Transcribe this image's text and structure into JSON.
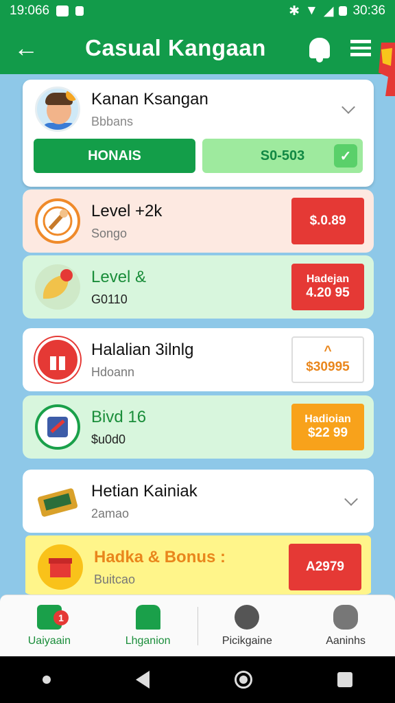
{
  "status_bar": {
    "time_left": "19:066",
    "time_right": "30:36"
  },
  "app_bar": {
    "title": "Casual Kangaan"
  },
  "profile": {
    "name": "Kanan Ksangan",
    "subtitle": "Bbbans",
    "primary_button": "HONAIS",
    "secondary_button": "S0-503"
  },
  "rows": [
    {
      "title": "Level +2k",
      "subtitle": "Songo",
      "pill_line1": "$.0.89",
      "pill_line2": ""
    },
    {
      "title": "Level &",
      "subtitle": "G0110",
      "pill_line1": "Hadejan",
      "pill_line2": "4.20 95"
    },
    {
      "title": "Halalian 3ilnlg",
      "subtitle": "Hdoann",
      "pill_line1": "^",
      "pill_line2": "$30995"
    },
    {
      "title": "Bivd 16",
      "subtitle": "$u0d0",
      "pill_line1": "Hadioian",
      "pill_line2": "$22 99"
    },
    {
      "title": "Hetian Kainiak",
      "subtitle": "2amao",
      "pill_line1": "",
      "pill_line2": ""
    },
    {
      "title": "Hadka & Bonus :",
      "subtitle": "Buitcao",
      "pill_line1": "A2979",
      "pill_line2": ""
    }
  ],
  "bottom_nav": [
    {
      "label": "Uaiyaain",
      "badge": "1"
    },
    {
      "label": "Lhganion"
    },
    {
      "label": "Picikgaine"
    },
    {
      "label": "Aaninhs"
    }
  ],
  "colors": {
    "brand_green": "#129b4a",
    "alert_red": "#e53935",
    "accent_orange": "#f8a21b",
    "background_blue": "#8ec8e8"
  }
}
